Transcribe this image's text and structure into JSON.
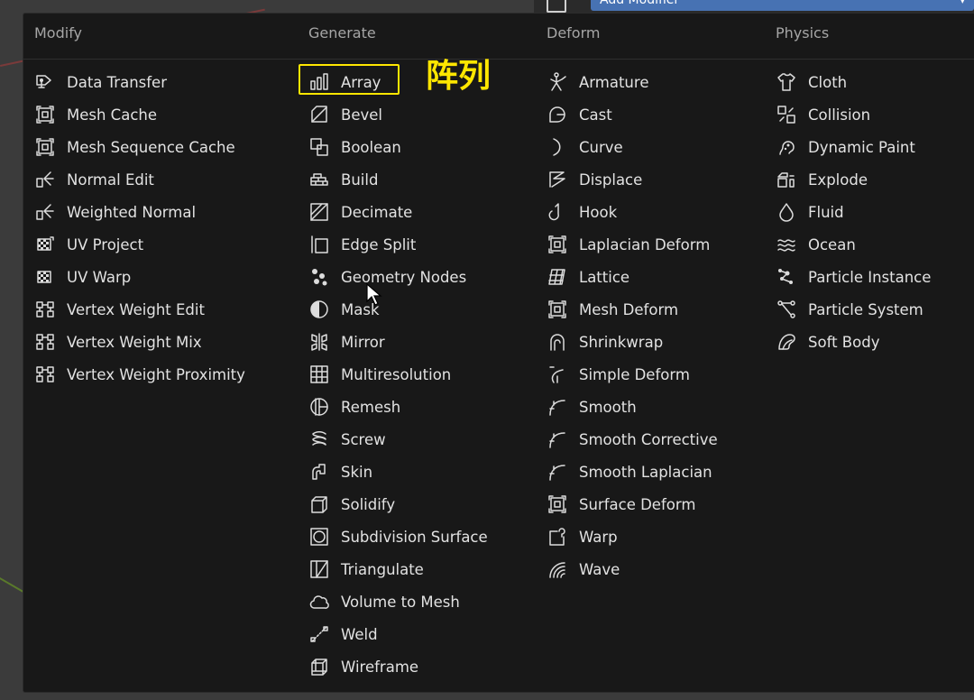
{
  "top_button": {
    "label": "Add Modifier"
  },
  "annotation": "阵列",
  "columns": [
    {
      "header": "Modify",
      "items": [
        {
          "label": "Data Transfer",
          "icon": "data-transfer-icon"
        },
        {
          "label": "Mesh Cache",
          "icon": "mesh-cache-icon"
        },
        {
          "label": "Mesh Sequence Cache",
          "icon": "mesh-sequence-cache-icon"
        },
        {
          "label": "Normal Edit",
          "icon": "normal-edit-icon"
        },
        {
          "label": "Weighted Normal",
          "icon": "weighted-normal-icon"
        },
        {
          "label": "UV Project",
          "icon": "uv-project-icon"
        },
        {
          "label": "UV Warp",
          "icon": "uv-warp-icon"
        },
        {
          "label": "Vertex Weight Edit",
          "icon": "vertex-weight-edit-icon"
        },
        {
          "label": "Vertex Weight Mix",
          "icon": "vertex-weight-mix-icon"
        },
        {
          "label": "Vertex Weight Proximity",
          "icon": "vertex-weight-proximity-icon"
        }
      ]
    },
    {
      "header": "Generate",
      "items": [
        {
          "label": "Array",
          "icon": "array-icon"
        },
        {
          "label": "Bevel",
          "icon": "bevel-icon"
        },
        {
          "label": "Boolean",
          "icon": "boolean-icon"
        },
        {
          "label": "Build",
          "icon": "build-icon"
        },
        {
          "label": "Decimate",
          "icon": "decimate-icon"
        },
        {
          "label": "Edge Split",
          "icon": "edge-split-icon"
        },
        {
          "label": "Geometry Nodes",
          "icon": "geometry-nodes-icon"
        },
        {
          "label": "Mask",
          "icon": "mask-icon"
        },
        {
          "label": "Mirror",
          "icon": "mirror-icon"
        },
        {
          "label": "Multiresolution",
          "icon": "multiresolution-icon"
        },
        {
          "label": "Remesh",
          "icon": "remesh-icon"
        },
        {
          "label": "Screw",
          "icon": "screw-icon"
        },
        {
          "label": "Skin",
          "icon": "skin-icon"
        },
        {
          "label": "Solidify",
          "icon": "solidify-icon"
        },
        {
          "label": "Subdivision Surface",
          "icon": "subdivision-surface-icon"
        },
        {
          "label": "Triangulate",
          "icon": "triangulate-icon"
        },
        {
          "label": "Volume to Mesh",
          "icon": "volume-to-mesh-icon"
        },
        {
          "label": "Weld",
          "icon": "weld-icon"
        },
        {
          "label": "Wireframe",
          "icon": "wireframe-icon"
        }
      ]
    },
    {
      "header": "Deform",
      "items": [
        {
          "label": "Armature",
          "icon": "armature-icon"
        },
        {
          "label": "Cast",
          "icon": "cast-icon"
        },
        {
          "label": "Curve",
          "icon": "curve-icon"
        },
        {
          "label": "Displace",
          "icon": "displace-icon"
        },
        {
          "label": "Hook",
          "icon": "hook-icon"
        },
        {
          "label": "Laplacian Deform",
          "icon": "laplacian-deform-icon"
        },
        {
          "label": "Lattice",
          "icon": "lattice-icon"
        },
        {
          "label": "Mesh Deform",
          "icon": "mesh-deform-icon"
        },
        {
          "label": "Shrinkwrap",
          "icon": "shrinkwrap-icon"
        },
        {
          "label": "Simple Deform",
          "icon": "simple-deform-icon"
        },
        {
          "label": "Smooth",
          "icon": "smooth-icon"
        },
        {
          "label": "Smooth Corrective",
          "icon": "smooth-corrective-icon"
        },
        {
          "label": "Smooth Laplacian",
          "icon": "smooth-laplacian-icon"
        },
        {
          "label": "Surface Deform",
          "icon": "surface-deform-icon"
        },
        {
          "label": "Warp",
          "icon": "warp-icon"
        },
        {
          "label": "Wave",
          "icon": "wave-icon"
        }
      ]
    },
    {
      "header": "Physics",
      "items": [
        {
          "label": "Cloth",
          "icon": "cloth-icon"
        },
        {
          "label": "Collision",
          "icon": "collision-icon"
        },
        {
          "label": "Dynamic Paint",
          "icon": "dynamic-paint-icon"
        },
        {
          "label": "Explode",
          "icon": "explode-icon"
        },
        {
          "label": "Fluid",
          "icon": "fluid-icon"
        },
        {
          "label": "Ocean",
          "icon": "ocean-icon"
        },
        {
          "label": "Particle Instance",
          "icon": "particle-instance-icon"
        },
        {
          "label": "Particle System",
          "icon": "particle-system-icon"
        },
        {
          "label": "Soft Body",
          "icon": "soft-body-icon"
        }
      ]
    }
  ],
  "colors": {
    "menu_bg": "#181818",
    "text": "#e2e2e2",
    "header": "#a6a6a6",
    "highlight": "#ffe600",
    "accent": "#4772b3"
  }
}
